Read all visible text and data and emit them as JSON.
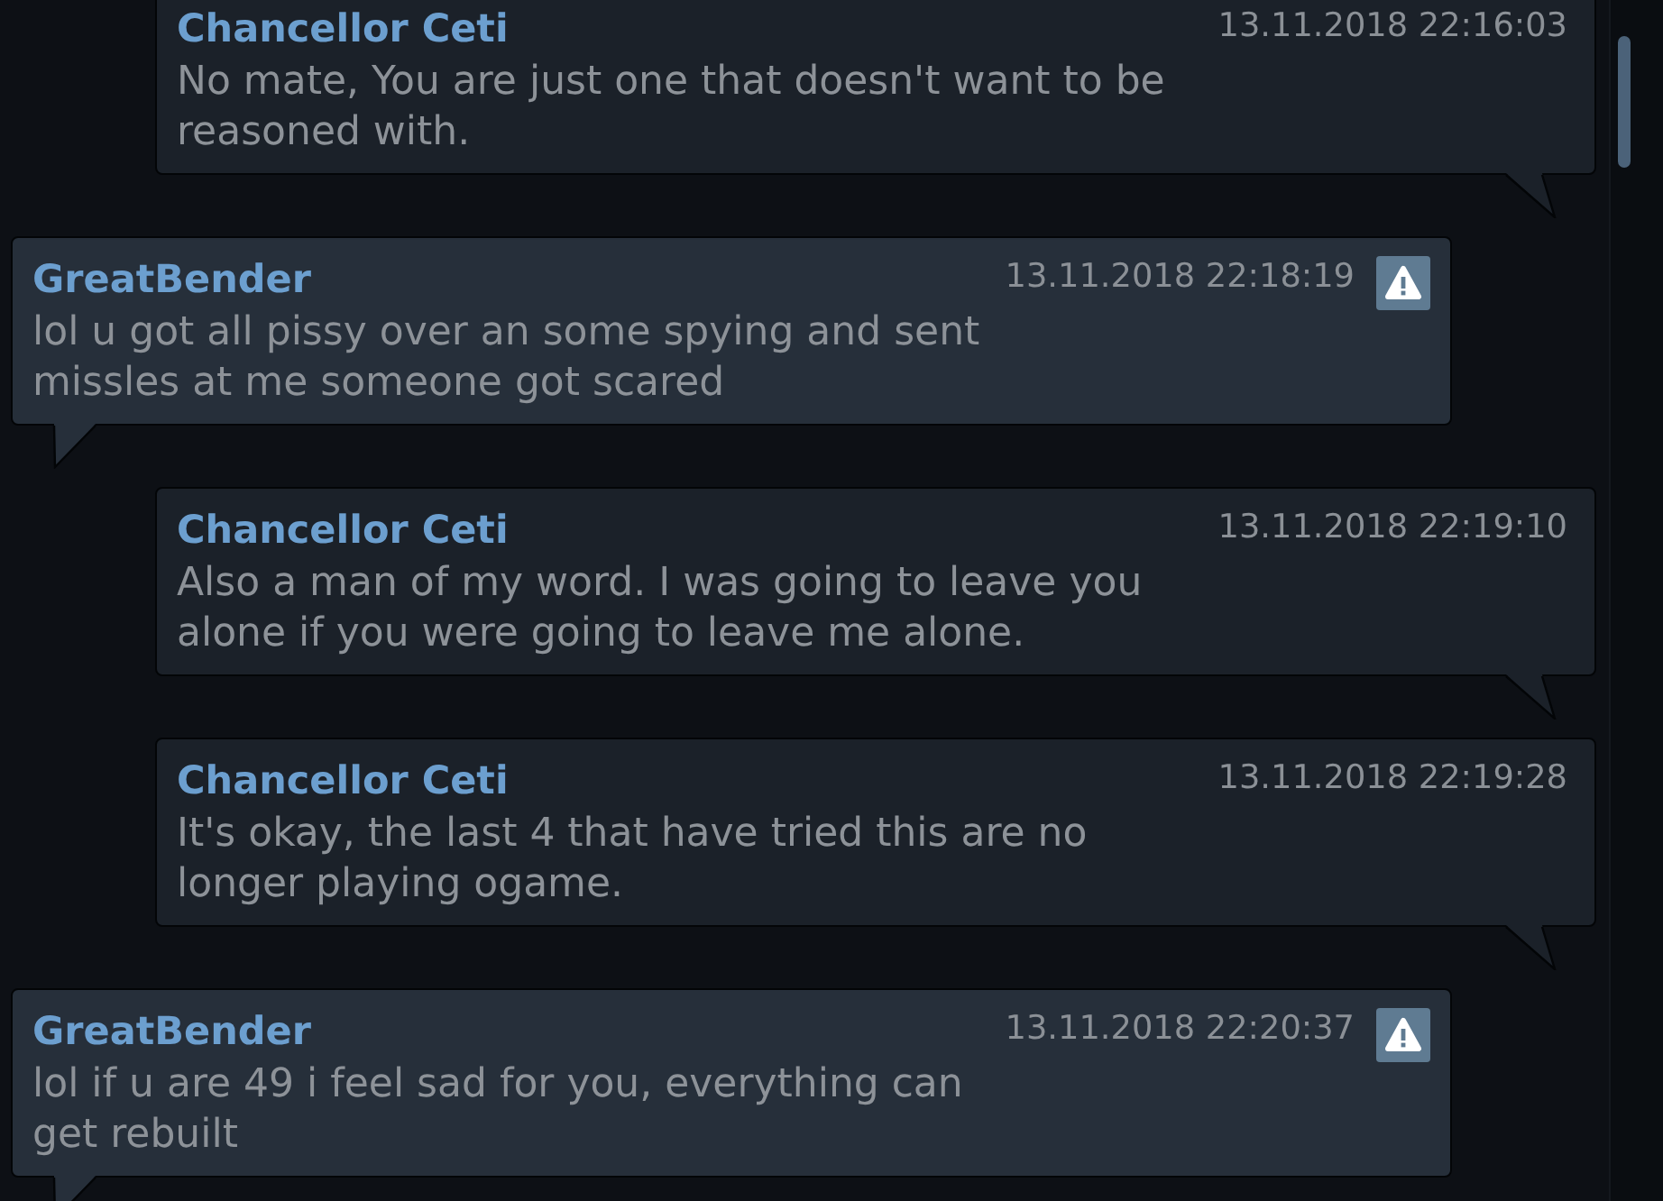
{
  "messages": [
    {
      "kind": "outgoing",
      "author": "Chancellor Ceti",
      "time": "13.11.2018 22:16:03",
      "text": "No mate, You are just one that doesn't want to be reasoned with."
    },
    {
      "kind": "incoming",
      "author": "GreatBender",
      "time": "13.11.2018 22:18:19",
      "text": "lol u got all pissy over an some spying and sent missles at me someone got scared"
    },
    {
      "kind": "outgoing",
      "author": "Chancellor Ceti",
      "time": "13.11.2018 22:19:10",
      "text": "Also a man of my word. I was going to leave you alone if you were going to leave me alone."
    },
    {
      "kind": "outgoing",
      "author": "Chancellor Ceti",
      "time": "13.11.2018 22:19:28",
      "text": "It's okay, the last 4 that have tried this are no longer playing ogame."
    },
    {
      "kind": "incoming",
      "author": "GreatBender",
      "time": "13.11.2018 22:20:37",
      "text": "lol if u are 49 i feel sad for you, everything can get rebuilt"
    }
  ]
}
